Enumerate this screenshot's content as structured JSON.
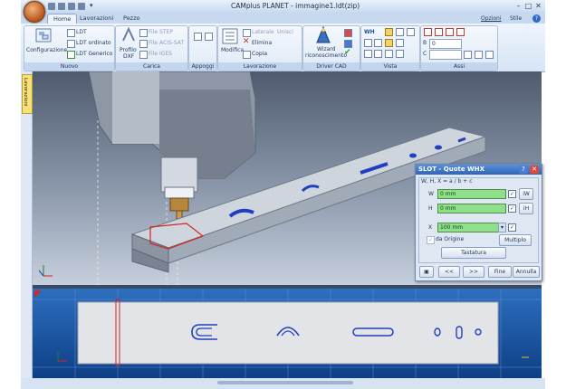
{
  "app": {
    "title": "CAMplus PLANET - immagine1.ldt(zip)",
    "options_label": "Opzioni",
    "style_label": "Stile",
    "help_icon": "help-icon"
  },
  "tabs": [
    {
      "label": "Home",
      "active": true
    },
    {
      "label": "Lavorazioni",
      "active": false
    },
    {
      "label": "Pezzo",
      "active": false
    }
  ],
  "ribbon": {
    "nuovo": {
      "label": "Nuovo",
      "configurazione": "Configurazione",
      "ldt": "LDT",
      "ldt_ordinato": "LDT ordinato",
      "ldt_generico": "LDT Generico"
    },
    "carica": {
      "label": "Carica",
      "profilo": "Profilo",
      "dxf": "DXF",
      "file_step": "File STEP",
      "file_acis": "File ACIS-SAT",
      "file_iges": "File IGES"
    },
    "appoggi": {
      "label": "Appoggi"
    },
    "lavorazione": {
      "label": "Lavorazione",
      "modifica": "Modifica",
      "lateralizza": "Laterale",
      "unisci": "Unisci",
      "elimina": "Elimina",
      "copia": "Copia"
    },
    "driver_cad": {
      "label": "Driver CAD",
      "wizard": "Wizard",
      "riconoscimento": "riconoscimento"
    },
    "vista": {
      "label": "Vista",
      "wh": "WH"
    },
    "assi": {
      "label": "Assi",
      "b_label": "B",
      "b_value": "0",
      "c_label": "C",
      "c_value": ""
    }
  },
  "left_tab": {
    "label": "Lavorazioni"
  },
  "dialog": {
    "title": "SLOT - Quote WHX",
    "help_button": "?",
    "close_button": "✕",
    "formula": "W, H, X = a / b + c",
    "w_label": "W",
    "w_value": "0 mm",
    "w_button": "iW",
    "h_label": "H",
    "h_value": "0 mm",
    "h_button": "iH",
    "x_label": "X",
    "x_value": "100 mm",
    "da_origine": "da Origine",
    "multiplo": "Multiplo",
    "tastatura": "Tastatura",
    "prev": "<<",
    "next": ">>",
    "fine": "Fine",
    "annulla": "Annulla"
  },
  "colors": {
    "accent": "#2d64b7",
    "field_green": "#8fe08a",
    "view_blue": "#1d5aa8"
  }
}
